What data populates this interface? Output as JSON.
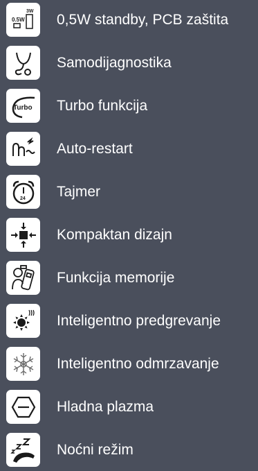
{
  "features": [
    {
      "label": "0,5W standby, PCB zaštita",
      "icon": "standby-pcb-icon",
      "icon_text": [
        "0.5W",
        "3W"
      ]
    },
    {
      "label": "Samodijagnostika",
      "icon": "self-diagnosis-icon"
    },
    {
      "label": "Turbo funkcija",
      "icon": "turbo-icon",
      "icon_text": [
        "Turbo"
      ]
    },
    {
      "label": "Auto-restart",
      "icon": "auto-restart-icon"
    },
    {
      "label": "Tajmer",
      "icon": "alarm-clock-icon",
      "icon_text": [
        "24"
      ]
    },
    {
      "label": "Kompaktan dizajn",
      "icon": "compact-arrows-icon"
    },
    {
      "label": "Funkcija memorije",
      "icon": "memory-remote-icon"
    },
    {
      "label": "Inteligentno predgrevanje",
      "icon": "preheat-fan-icon"
    },
    {
      "label": "Inteligentno odmrzavanje",
      "icon": "defrost-snowflake-icon"
    },
    {
      "label": "Hladna plazma",
      "icon": "cold-plasma-icon"
    },
    {
      "label": "Noćni režim",
      "icon": "night-mode-icon"
    }
  ],
  "colors": {
    "background": "#4a4f5c",
    "icon_bg": "#ffffff",
    "icon_fg": "#1a1a1a",
    "text": "#ffffff"
  }
}
